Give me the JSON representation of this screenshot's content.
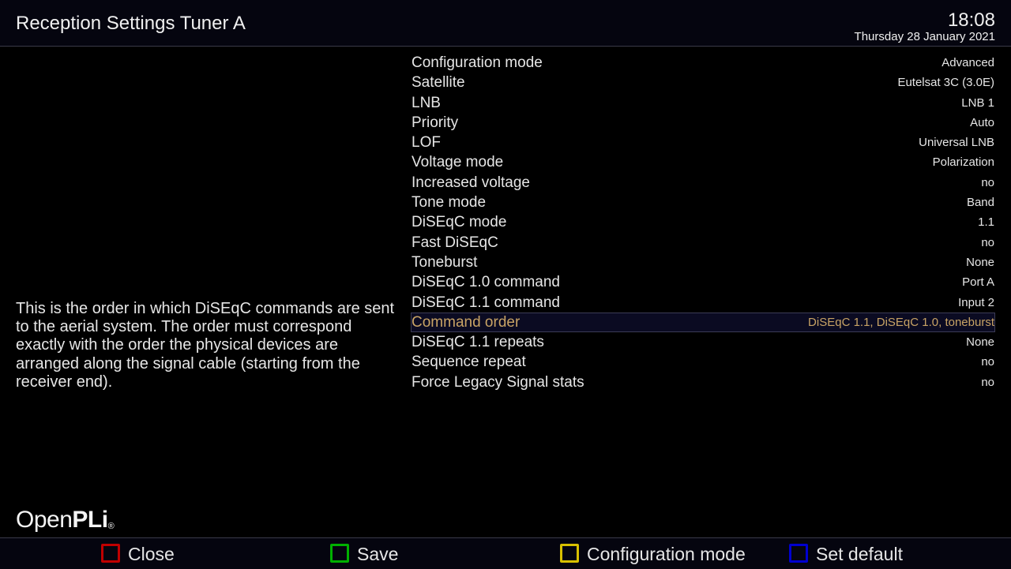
{
  "header": {
    "title": "Reception Settings Tuner A",
    "time": "18:08",
    "date": "Thursday 28 January 2021"
  },
  "description": "This is the order in which DiSEqC commands are sent to the aerial system. The order must correspond exactly with the order the physical devices are arranged along the signal cable (starting from the receiver end).",
  "settings": [
    {
      "label": "Configuration mode",
      "value": "Advanced"
    },
    {
      "label": "Satellite",
      "value": "Eutelsat 3C (3.0E)"
    },
    {
      "label": "LNB",
      "value": "LNB 1"
    },
    {
      "label": "Priority",
      "value": "Auto"
    },
    {
      "label": "LOF",
      "value": "Universal LNB"
    },
    {
      "label": "Voltage mode",
      "value": "Polarization"
    },
    {
      "label": "Increased voltage",
      "value": "no"
    },
    {
      "label": "Tone mode",
      "value": "Band"
    },
    {
      "label": "DiSEqC mode",
      "value": "1.1"
    },
    {
      "label": "Fast DiSEqC",
      "value": "no"
    },
    {
      "label": "Toneburst",
      "value": "None"
    },
    {
      "label": "DiSEqC 1.0 command",
      "value": "Port A"
    },
    {
      "label": "DiSEqC 1.1 command",
      "value": "Input 2"
    },
    {
      "label": "Command order",
      "value": "DiSEqC 1.1, DiSEqC 1.0, toneburst"
    },
    {
      "label": "DiSEqC 1.1 repeats",
      "value": "None"
    },
    {
      "label": "Sequence repeat",
      "value": "no"
    },
    {
      "label": "Force Legacy Signal stats",
      "value": "no"
    }
  ],
  "selected_index": 13,
  "logo": {
    "part1": "Open",
    "part2": "PLi",
    "mark": "®"
  },
  "footer": {
    "red": {
      "label": "Close",
      "color": "#c00000"
    },
    "green": {
      "label": "Save",
      "color": "#00b000"
    },
    "yellow": {
      "label": "Configuration mode",
      "color": "#d8c000"
    },
    "blue": {
      "label": "Set default",
      "color": "#0000d0"
    }
  },
  "colors": {
    "background": "#000000",
    "bar_background": "#05050f",
    "selected_text": "#c8a365",
    "text": "#e6e6e6"
  }
}
